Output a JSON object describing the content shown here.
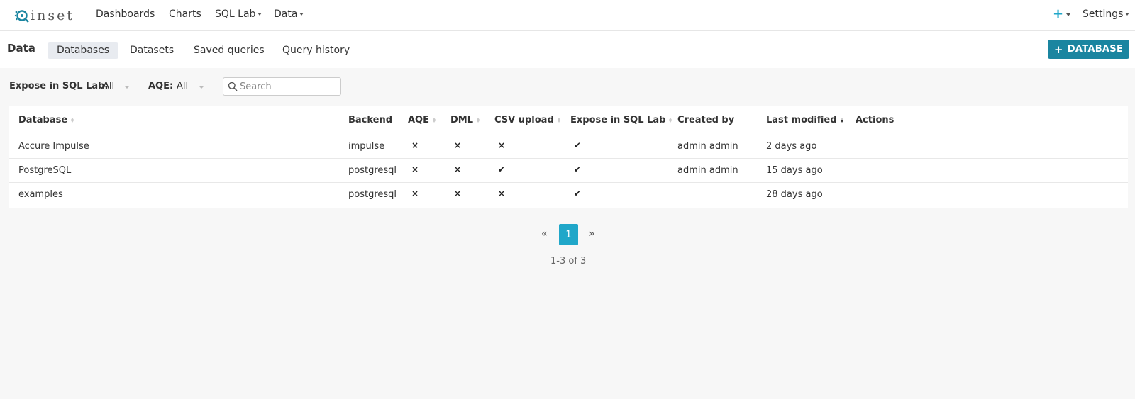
{
  "nav": {
    "logo_text": "inset",
    "items": [
      {
        "label": "Dashboards",
        "caret": false
      },
      {
        "label": "Charts",
        "caret": false
      },
      {
        "label": "SQL Lab",
        "caret": true
      },
      {
        "label": "Data",
        "caret": true
      }
    ],
    "settings_label": "Settings",
    "plus_glyph": "+"
  },
  "subheader": {
    "title": "Data",
    "tabs": [
      {
        "label": "Databases",
        "active": true
      },
      {
        "label": "Datasets",
        "active": false
      },
      {
        "label": "Saved queries",
        "active": false
      },
      {
        "label": "Query history",
        "active": false
      }
    ],
    "add_button_label": "DATABASE",
    "add_button_glyph": "+"
  },
  "filters": {
    "expose_label": "Expose in SQL Lab:",
    "expose_value": "All",
    "aqe_label": "AQE:",
    "aqe_value": "All",
    "search_placeholder": "Search"
  },
  "table": {
    "headers": [
      "Database",
      "Backend",
      "AQE",
      "DML",
      "CSV upload",
      "Expose in SQL Lab",
      "Created by",
      "Last modified",
      "Actions"
    ],
    "rows": [
      {
        "database": "Accure Impulse",
        "backend": "impulse",
        "aqe": "×",
        "dml": "×",
        "csv": "×",
        "expose": "✔",
        "created_by": "admin admin",
        "modified": "2 days ago"
      },
      {
        "database": "PostgreSQL",
        "backend": "postgresql",
        "aqe": "×",
        "dml": "×",
        "csv": "✔",
        "expose": "✔",
        "created_by": "admin admin",
        "modified": "15 days ago"
      },
      {
        "database": "examples",
        "backend": "postgresql",
        "aqe": "×",
        "dml": "×",
        "csv": "×",
        "expose": "✔",
        "created_by": "",
        "modified": "28 days ago"
      }
    ]
  },
  "pagination": {
    "prev": "«",
    "page": "1",
    "next": "»",
    "count": "1-3 of 3"
  },
  "colors": {
    "accent": "#20a7c9",
    "button": "#1a85a0"
  }
}
